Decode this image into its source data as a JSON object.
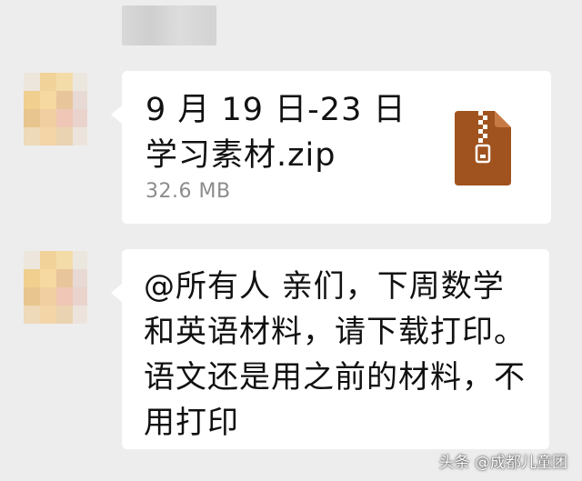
{
  "chat": {
    "sender_name_blurred": true,
    "messages": [
      {
        "type": "file",
        "file_name": "9 月 19 日-23 日学习素材.zip",
        "file_size": "32.6 MB",
        "file_icon": "zip-file-icon",
        "icon_color": "#a0531e"
      },
      {
        "type": "text",
        "text": "@所有人 亲们，下周数学\n和英语材料，请下载打印。\n语文还是用之前的材料，不\n用打印"
      }
    ]
  },
  "watermark": "头条 @成都儿童团",
  "colors": {
    "background": "#ededed",
    "bubble": "#ffffff",
    "text": "#111111",
    "secondary_text": "#8c8c8c"
  }
}
